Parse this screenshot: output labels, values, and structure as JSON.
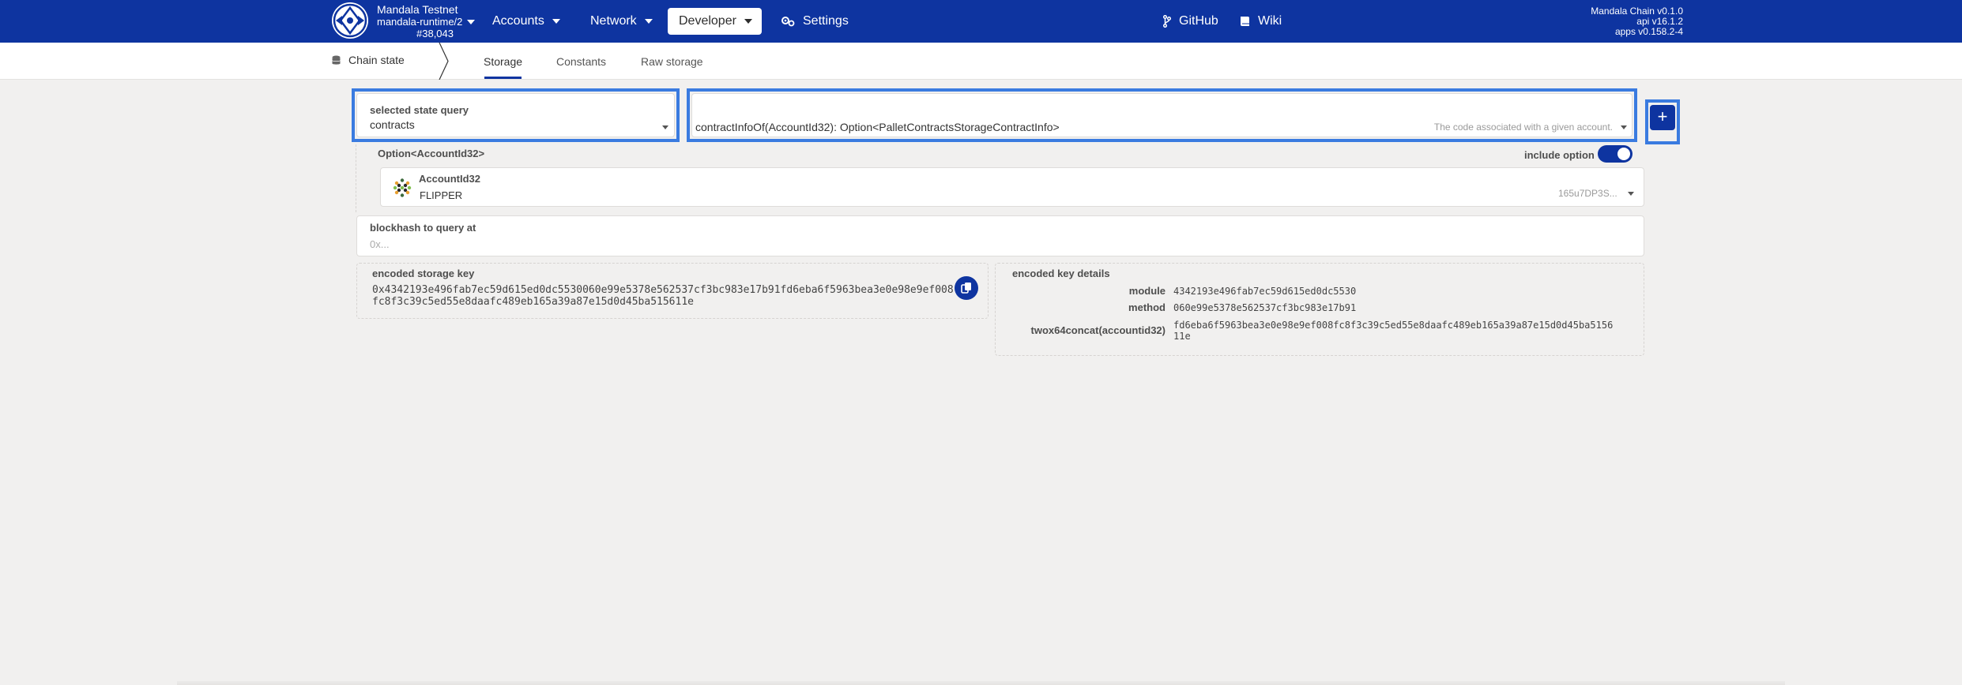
{
  "header": {
    "chain_name": "Mandala Testnet",
    "runtime": "mandala-runtime/2",
    "block": "#38,043",
    "nav": {
      "accounts": "Accounts",
      "network": "Network",
      "developer": "Developer",
      "settings": "Settings",
      "github": "GitHub",
      "wiki": "Wiki"
    },
    "versions": {
      "chain": "Mandala Chain v0.1.0",
      "api": "api v16.1.2",
      "apps": "apps v0.158.2-4"
    }
  },
  "subnav": {
    "root": "Chain state",
    "tabs": [
      "Storage",
      "Constants",
      "Raw storage"
    ],
    "active_tab": "Storage"
  },
  "query": {
    "module_label": "selected state query",
    "module_value": "contracts",
    "method_value": "contractInfoOf(AccountId32): Option<PalletContractsStorageContractInfo>",
    "method_hint": "The code associated with a given account.",
    "add_label": "+"
  },
  "param": {
    "title": "Option<AccountId32>",
    "include_option_label": "include option",
    "include_option": true,
    "account_type": "AccountId32",
    "account_name": "FLIPPER",
    "account_address": "165u7DP3S..."
  },
  "blockhash": {
    "label": "blockhash to query at",
    "placeholder": "0x..."
  },
  "encoded": {
    "key_label": "encoded storage key",
    "key_value": "0x4342193e496fab7ec59d615ed0dc5530060e99e5378e562537cf3bc983e17b91fd6eba6f5963bea3e0e98e9ef008fc8f3c39c5ed55e8daafc489eb165a39a87e15d0d45ba515611e",
    "details_label": "encoded key details",
    "details": [
      {
        "label": "module",
        "value": "4342193e496fab7ec59d615ed0dc5530"
      },
      {
        "label": "method",
        "value": "060e99e5378e562537cf3bc983e17b91"
      },
      {
        "label": "twox64concat(accountid32)",
        "value": "fd6eba6f5963bea3e0e98e9ef008fc8f3c39c5ed55e8daafc489eb165a39a87e15d0d45ba515611e"
      }
    ]
  },
  "colors": {
    "brand": "#0e34a0",
    "highlight": "#3a7be0",
    "background": "#f1f0ef"
  }
}
